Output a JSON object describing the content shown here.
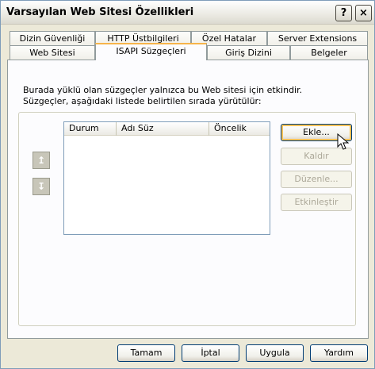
{
  "window": {
    "title": "Varsayılan Web Sitesi Özellikleri",
    "help_glyph": "?",
    "close_glyph": "×"
  },
  "tabs_row1": [
    {
      "label": "Dizin Güvenliği"
    },
    {
      "label": "HTTP Üstbilgileri"
    },
    {
      "label": "Özel Hatalar"
    },
    {
      "label": "Server Extensions"
    }
  ],
  "tabs_row2": [
    {
      "label": "Web Sitesi"
    },
    {
      "label": "ISAPI Süzgeçleri",
      "active": true
    },
    {
      "label": "Giriş Dizini"
    },
    {
      "label": "Belgeler"
    }
  ],
  "description": "Burada yüklü olan süzgeçler yalnızca bu Web sitesi için etkindir. Süzgeçler, aşağıdaki listede belirtilen sırada yürütülür:",
  "list": {
    "columns": [
      "Durum",
      "Adı Süz",
      "Öncelik"
    ],
    "rows": []
  },
  "side_buttons": {
    "add": "Ekle...",
    "remove": "Kaldır",
    "edit": "Düzenle...",
    "enable": "Etkinleştir"
  },
  "arrows": {
    "up_icon": "arrow-up-icon",
    "up_glyph": "↥",
    "down_icon": "arrow-down-icon",
    "down_glyph": "↧"
  },
  "footer": {
    "ok": "Tamam",
    "cancel": "İptal",
    "apply": "Uygula",
    "help": "Yardım"
  },
  "colors": {
    "tab_active_accent": "#f6b44a",
    "dialog_bg": "#ece9d8",
    "panel_bg": "#fcfcfe"
  }
}
